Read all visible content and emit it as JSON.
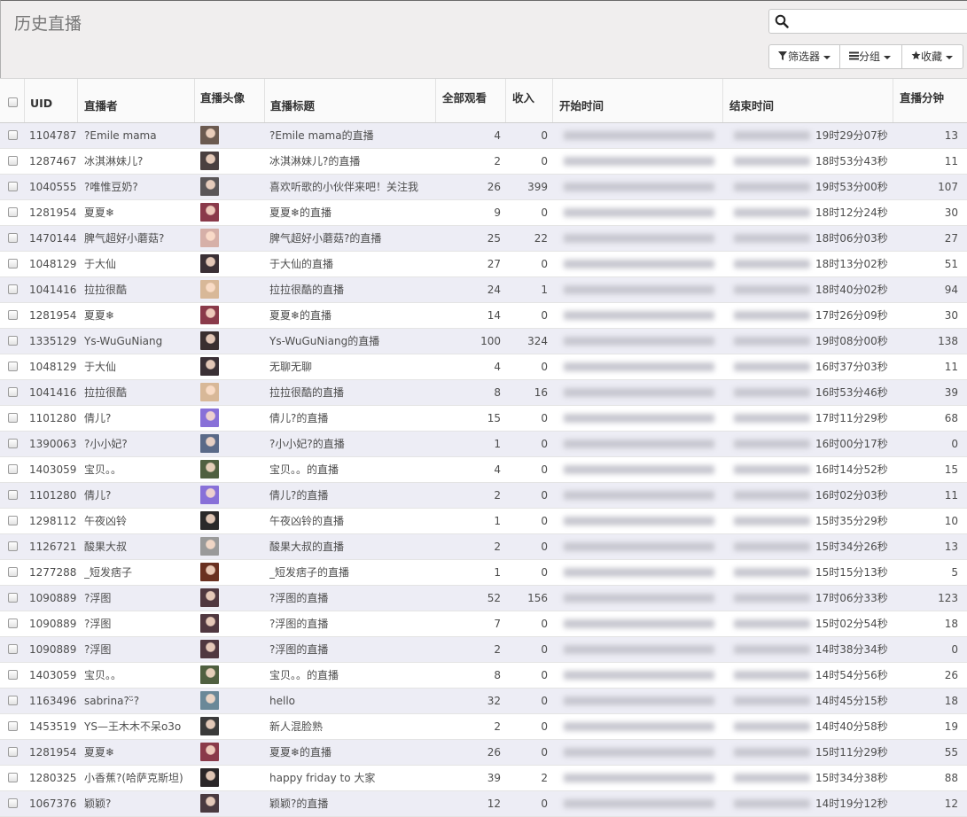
{
  "header": {
    "title": "历史直播",
    "search_placeholder": "",
    "filter_label": "筛选器",
    "group_label": "分组",
    "favorites_label": "收藏"
  },
  "icons": {
    "search": "search-icon",
    "filter": "filter-icon",
    "group": "list-icon",
    "favorites": "star-icon"
  },
  "columns": [
    "UID",
    "直播者",
    "直播头像",
    "直播标题",
    "全部观看",
    "收入",
    "开始时间",
    "结束时间",
    "直播分钟"
  ],
  "rows": [
    {
      "uid": "1104787",
      "streamer": "?Emile mama",
      "title": "?Emile mama的直播",
      "views": "4",
      "income": "0",
      "end": "19时29分07秒",
      "minutes": "13",
      "color": "#6b5a50"
    },
    {
      "uid": "1287467",
      "streamer": "冰淇淋妹儿?",
      "title": "冰淇淋妹儿?的直播",
      "views": "2",
      "income": "0",
      "end": "18时53分43秒",
      "minutes": "11",
      "color": "#4a4040"
    },
    {
      "uid": "1040555",
      "streamer": "?唯惟豆奶?",
      "title": "喜欢听歌的小伙伴来吧！关注我",
      "views": "26",
      "income": "399",
      "end": "19时53分00秒",
      "minutes": "107",
      "color": "#5a5658"
    },
    {
      "uid": "1281954",
      "streamer": "夏夏❄",
      "title": "夏夏❄的直播",
      "views": "9",
      "income": "0",
      "end": "18时12分24秒",
      "minutes": "30",
      "color": "#8a3a4a"
    },
    {
      "uid": "1470144",
      "streamer": "脾气超好小蘑菇?",
      "title": "脾气超好小蘑菇?的直播",
      "views": "25",
      "income": "22",
      "end": "18时06分03秒",
      "minutes": "27",
      "color": "#d6b0a8"
    },
    {
      "uid": "1048129",
      "streamer": "于大仙",
      "title": "于大仙的直播",
      "views": "27",
      "income": "0",
      "end": "18时13分02秒",
      "minutes": "51",
      "color": "#3a3035"
    },
    {
      "uid": "1041416",
      "streamer": "拉拉很酷",
      "title": "拉拉很酷的直播",
      "views": "24",
      "income": "1",
      "end": "18时40分02秒",
      "minutes": "94",
      "color": "#d8b898"
    },
    {
      "uid": "1281954",
      "streamer": "夏夏❄",
      "title": "夏夏❄的直播",
      "views": "14",
      "income": "0",
      "end": "17时26分09秒",
      "minutes": "30",
      "color": "#8a3a4a"
    },
    {
      "uid": "1335129",
      "streamer": "Ys-WuGuNiang",
      "title": "Ys-WuGuNiang的直播",
      "views": "100",
      "income": "324",
      "end": "19时08分00秒",
      "minutes": "138",
      "color": "#3a2f30"
    },
    {
      "uid": "1048129",
      "streamer": "于大仙",
      "title": "无聊无聊",
      "views": "4",
      "income": "0",
      "end": "16时37分03秒",
      "minutes": "11",
      "color": "#3a3035"
    },
    {
      "uid": "1041416",
      "streamer": "拉拉很酷",
      "title": "拉拉很酷的直播",
      "views": "8",
      "income": "16",
      "end": "16时53分46秒",
      "minutes": "39",
      "color": "#d8b898"
    },
    {
      "uid": "1101280",
      "streamer": "倩儿?",
      "title": "倩儿?的直播",
      "views": "15",
      "income": "0",
      "end": "17时11分29秒",
      "minutes": "68",
      "color": "#8870d8"
    },
    {
      "uid": "1390063",
      "streamer": "?小小妃?",
      "title": "?小小妃?的直播",
      "views": "1",
      "income": "0",
      "end": "16时00分17秒",
      "minutes": "0",
      "color": "#5a6a88"
    },
    {
      "uid": "1403059",
      "streamer": "宝贝。。",
      "title": "宝贝。。的直播",
      "views": "4",
      "income": "0",
      "end": "16时14分52秒",
      "minutes": "15",
      "color": "#506040"
    },
    {
      "uid": "1101280",
      "streamer": "倩儿?",
      "title": "倩儿?的直播",
      "views": "2",
      "income": "0",
      "end": "16时02分03秒",
      "minutes": "11",
      "color": "#8870d8"
    },
    {
      "uid": "1298112",
      "streamer": "午夜凶铃",
      "title": "午夜凶铃的直播",
      "views": "1",
      "income": "0",
      "end": "15时35分29秒",
      "minutes": "10",
      "color": "#2a2a2a"
    },
    {
      "uid": "1126721",
      "streamer": "酸果大叔",
      "title": "酸果大叔的直播",
      "views": "2",
      "income": "0",
      "end": "15时34分26秒",
      "minutes": "13",
      "color": "#9a9a9a"
    },
    {
      "uid": "1277288",
      "streamer": "_短发痞子",
      "title": "_短发痞子的直播",
      "views": "1",
      "income": "0",
      "end": "15时15分13秒",
      "minutes": "5",
      "color": "#6a3020"
    },
    {
      "uid": "1090889",
      "streamer": "?浮图",
      "title": "?浮图的直播",
      "views": "52",
      "income": "156",
      "end": "17时06分33秒",
      "minutes": "123",
      "color": "#503840"
    },
    {
      "uid": "1090889",
      "streamer": "?浮图",
      "title": "?浮图的直播",
      "views": "7",
      "income": "0",
      "end": "15时02分54秒",
      "minutes": "18",
      "color": "#503840"
    },
    {
      "uid": "1090889",
      "streamer": "?浮图",
      "title": "?浮图的直播",
      "views": "2",
      "income": "0",
      "end": "14时38分34秒",
      "minutes": "0",
      "color": "#503840"
    },
    {
      "uid": "1403059",
      "streamer": "宝贝。。",
      "title": "宝贝。。的直播",
      "views": "8",
      "income": "0",
      "end": "14时54分56秒",
      "minutes": "26",
      "color": "#506040"
    },
    {
      "uid": "1163496",
      "streamer": "sabrina?ᵕ̈?",
      "title": "hello",
      "views": "32",
      "income": "0",
      "end": "14时45分15秒",
      "minutes": "18",
      "color": "#6a8898"
    },
    {
      "uid": "1453519",
      "streamer": "YS—王木木不呆o3o",
      "title": "新人混脸熟",
      "views": "2",
      "income": "0",
      "end": "14时40分58秒",
      "minutes": "19",
      "color": "#3a3a3a"
    },
    {
      "uid": "1281954",
      "streamer": "夏夏❄",
      "title": "夏夏❄的直播",
      "views": "26",
      "income": "0",
      "end": "15时11分29秒",
      "minutes": "55",
      "color": "#8a3a4a"
    },
    {
      "uid": "1280325",
      "streamer": "小香蕉?(哈萨克斯坦)",
      "title": "happy friday to 大家",
      "views": "39",
      "income": "2",
      "end": "15时34分38秒",
      "minutes": "88",
      "color": "#2a2628"
    },
    {
      "uid": "1067376",
      "streamer": "颖颖?",
      "title": "颖颖?的直播",
      "views": "12",
      "income": "0",
      "end": "14时19分12秒",
      "minutes": "12",
      "color": "#4a3a40"
    }
  ],
  "colors": {
    "odd_row": "#ededf5",
    "even_row": "#ffffff",
    "topbar": "#f0eeee"
  }
}
